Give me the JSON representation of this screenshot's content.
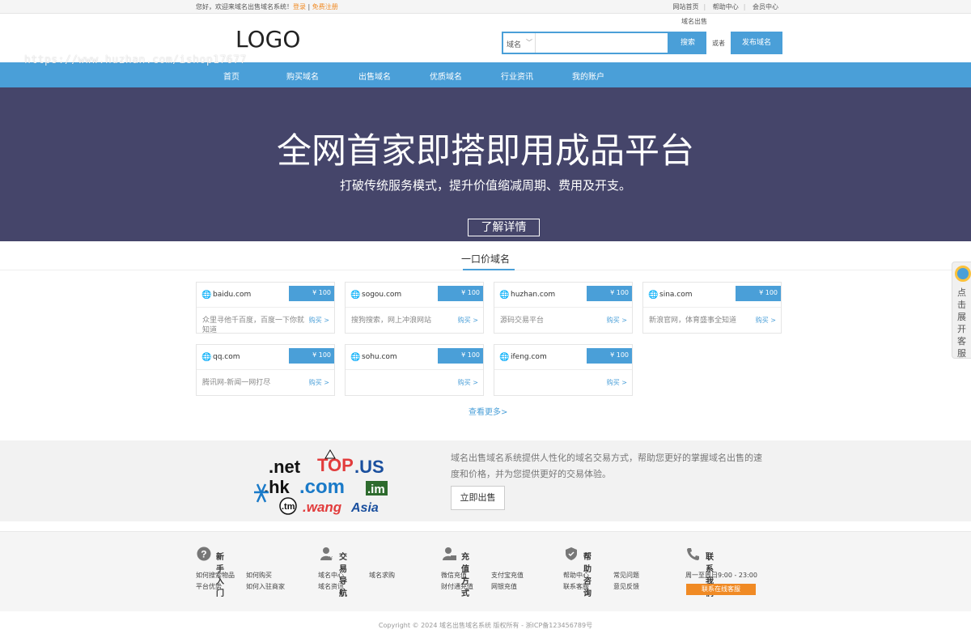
{
  "topbar": {
    "welcome": "您好，欢迎来域名出售域名系统！",
    "login": "登录",
    "sep": " | ",
    "register": "免费注册",
    "links": [
      "网站首页",
      "帮助中心",
      "会员中心"
    ]
  },
  "header": {
    "logo": "LOGO",
    "sold_tag": "域名出售",
    "search_select": "域名",
    "search_placeholder": "",
    "search_button": "搜索",
    "or": "或者",
    "publish_button": "发布域名",
    "watermark": "https://www.huzhan.com/ishop17677"
  },
  "nav": [
    "首页",
    "购买域名",
    "出售域名",
    "优质域名",
    "行业资讯",
    "我的账户"
  ],
  "banner": {
    "title": "全网首家即搭即用成品平台",
    "subtitle": "打破传统服务模式，提升价值缩减周期、费用及开支。",
    "button": "了解详情"
  },
  "section_title": "一口价域名",
  "domains": [
    {
      "name": "baidu.com",
      "price": "¥ 100",
      "desc": "众里寻他千百度，百度一下你就知道",
      "buy": "购买 >"
    },
    {
      "name": "sogou.com",
      "price": "¥ 100",
      "desc": "搜狗搜索，网上冲浪网站",
      "buy": "购买 >"
    },
    {
      "name": "huzhan.com",
      "price": "¥ 100",
      "desc": "源码交易平台",
      "buy": "购买 >"
    },
    {
      "name": "sina.com",
      "price": "¥ 100",
      "desc": "新浪官网，体育盛事全知道",
      "buy": "购买 >"
    },
    {
      "name": "qq.com",
      "price": "¥ 100",
      "desc": "腾讯网-新闻一网打尽",
      "buy": "购买 >"
    },
    {
      "name": "sohu.com",
      "price": "¥ 100",
      "desc": "",
      "buy": "购买 >"
    },
    {
      "name": "ifeng.com",
      "price": "¥ 100",
      "desc": "",
      "buy": "购买 >"
    }
  ],
  "more": "查看更多>",
  "promo": {
    "tlds": [
      ".net",
      "TOP",
      ".US",
      ".hk",
      ".com",
      ".im",
      ".tm",
      ".wang",
      "Asia"
    ],
    "text": "域名出售域名系统提供人性化的域名交易方式，帮助您更好的掌握域名出售的速度和价格，并为您提供更好的交易体验。",
    "button": "立即出售"
  },
  "footer": {
    "cols": [
      {
        "title": "新手入门",
        "icon": "question-icon",
        "links": [
          "如何搜索物品",
          "如何购买",
          "平台优势",
          "如何入驻商家"
        ]
      },
      {
        "title": "交易导航",
        "icon": "user-icon",
        "links": [
          "域名中心",
          "域名求购",
          "域名资讯"
        ]
      },
      {
        "title": "充值方式",
        "icon": "user-pay-icon",
        "links": [
          "微信充值",
          "支付宝充值",
          "财付通充值",
          "网银充值"
        ]
      },
      {
        "title": "帮助咨询",
        "icon": "shield-icon",
        "links": [
          "帮助中心",
          "常见问题",
          "联系客服",
          "意见反馈"
        ]
      },
      {
        "title": "联系我们",
        "icon": "phone-icon",
        "links": [
          "周一至周日9:00 - 23:00"
        ],
        "button": "联系在线客服"
      }
    ],
    "copyright": "Copyright © 2024 域名出售域名系统 版权所有 - 浙ICP备123456789号"
  },
  "service": "点击展开客服",
  "colors": {
    "primary": "#4a9fd8",
    "banner": "#45456a",
    "accent": "#f08a24"
  }
}
